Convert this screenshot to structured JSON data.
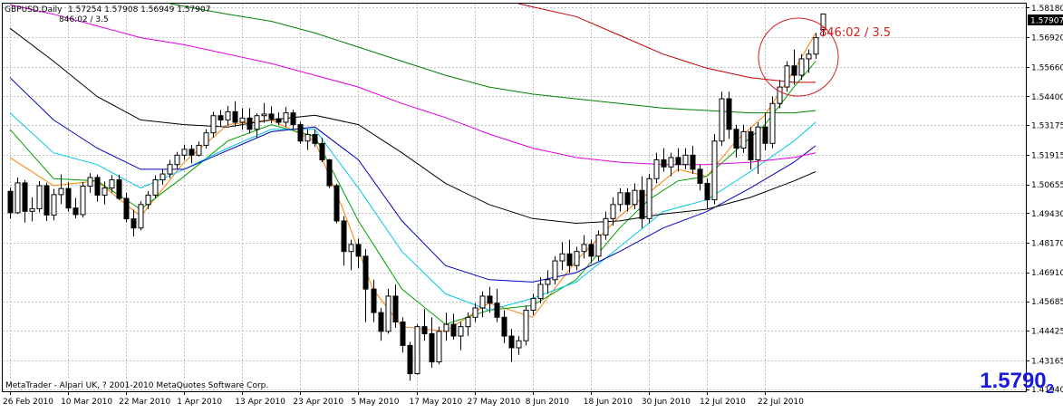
{
  "header": {
    "symbol_tf": "GBPUSD,Daily",
    "ohlc": "1.57254 1.57908 1.56949 1.57907",
    "indicator_readout": "846:02 / 3.5"
  },
  "annotation": {
    "text": "846:02 / 3.5",
    "color": "#d02020"
  },
  "footer": {
    "copyright": "MetaTrader - Alpari UK, ? 2001-2010 MetaQuotes Software Corp."
  },
  "price_big": {
    "main": "1.5790",
    "sub": "2",
    "color": "#1a1adf"
  },
  "colors": {
    "bull_body": "#ffffff",
    "bear_body": "#000000",
    "grid": "#c0c0c0",
    "current_price_box": "#000000"
  },
  "chart_data": {
    "type": "candlestick",
    "title": "GBPUSD,Daily",
    "current_price": "1.57907",
    "y_tick_labels": [
      "1.58180",
      "1.56920",
      "1.55660",
      "1.54400",
      "1.53175",
      "1.51915",
      "1.50655",
      "1.49430",
      "1.48170",
      "1.46910",
      "1.45685",
      "1.44425",
      "1.43165",
      "1.41940"
    ],
    "y_ticks": [
      1.5818,
      1.5692,
      1.5566,
      1.544,
      1.53175,
      1.51915,
      1.50655,
      1.4943,
      1.4817,
      1.4691,
      1.45685,
      1.44425,
      1.43165,
      1.4194
    ],
    "ylim": [
      1.4185,
      1.5835
    ],
    "x_tick_labels": [
      "26 Feb 2010",
      "10 Mar 2010",
      "22 Mar 2010",
      "1 Apr 2010",
      "13 Apr 2010",
      "23 Apr 2010",
      "5 May 2010",
      "17 May 2010",
      "27 May 2010",
      "8 Jun 2010",
      "18 Jun 2010",
      "30 Jun 2010",
      "12 Jul 2010",
      "22 Jul 2010"
    ],
    "x_tick_bar_index": [
      0,
      8,
      16,
      24,
      32,
      40,
      48,
      56,
      64,
      72,
      80,
      88,
      96,
      104
    ],
    "bar_count": 110,
    "candles_ohlc": [
      [
        1.5036,
        1.5052,
        1.492,
        1.4945
      ],
      [
        1.4945,
        1.5095,
        1.494,
        1.5072
      ],
      [
        1.5072,
        1.5084,
        1.4903,
        1.4951
      ],
      [
        1.4951,
        1.501,
        1.4908,
        1.4962
      ],
      [
        1.4962,
        1.508,
        1.4947,
        1.506
      ],
      [
        1.506,
        1.5072,
        1.491,
        1.4935
      ],
      [
        1.4935,
        1.5046,
        1.4912,
        1.5022
      ],
      [
        1.5022,
        1.5108,
        1.4982,
        1.5048
      ],
      [
        1.5048,
        1.5074,
        1.495,
        1.4965
      ],
      [
        1.4965,
        1.5008,
        1.4922,
        1.4937
      ],
      [
        1.4937,
        1.5075,
        1.4924,
        1.5058
      ],
      [
        1.5058,
        1.5113,
        1.503,
        1.5095
      ],
      [
        1.5095,
        1.5108,
        1.4992,
        1.502
      ],
      [
        1.502,
        1.5078,
        1.498,
        1.505
      ],
      [
        1.505,
        1.5105,
        1.5031,
        1.5085
      ],
      [
        1.5085,
        1.5107,
        1.4999,
        1.5006
      ],
      [
        1.5006,
        1.503,
        1.4905,
        1.4919
      ],
      [
        1.4919,
        1.4958,
        1.4844,
        1.488
      ],
      [
        1.488,
        1.4994,
        1.487,
        1.498
      ],
      [
        1.498,
        1.5037,
        1.4961,
        1.502
      ],
      [
        1.502,
        1.5104,
        1.5006,
        1.5085
      ],
      [
        1.5085,
        1.513,
        1.5065,
        1.511
      ],
      [
        1.511,
        1.517,
        1.5092,
        1.515
      ],
      [
        1.515,
        1.5204,
        1.5132,
        1.519
      ],
      [
        1.519,
        1.5235,
        1.517,
        1.5215
      ],
      [
        1.5215,
        1.5234,
        1.5155,
        1.519
      ],
      [
        1.519,
        1.5248,
        1.5184,
        1.5232
      ],
      [
        1.5232,
        1.53,
        1.5218,
        1.5285
      ],
      [
        1.5285,
        1.5375,
        1.5265,
        1.5358
      ],
      [
        1.5358,
        1.5382,
        1.5312,
        1.534
      ],
      [
        1.534,
        1.54,
        1.5316,
        1.5375
      ],
      [
        1.5375,
        1.542,
        1.531,
        1.533
      ],
      [
        1.533,
        1.539,
        1.5298,
        1.5348
      ],
      [
        1.5348,
        1.539,
        1.5282,
        1.53
      ],
      [
        1.53,
        1.5368,
        1.5264,
        1.5358
      ],
      [
        1.5358,
        1.5412,
        1.5328,
        1.5365
      ],
      [
        1.5365,
        1.5398,
        1.5325,
        1.5345
      ],
      [
        1.5345,
        1.5372,
        1.5318,
        1.533
      ],
      [
        1.533,
        1.5395,
        1.531,
        1.537
      ],
      [
        1.537,
        1.5383,
        1.53,
        1.532
      ],
      [
        1.532,
        1.5332,
        1.5238,
        1.525
      ],
      [
        1.525,
        1.53,
        1.5212,
        1.5278
      ],
      [
        1.5278,
        1.53,
        1.5225,
        1.524
      ],
      [
        1.524,
        1.5263,
        1.516,
        1.517
      ],
      [
        1.517,
        1.5174,
        1.505,
        1.506
      ],
      [
        1.506,
        1.5068,
        1.49,
        1.491
      ],
      [
        1.491,
        1.493,
        1.472,
        1.478
      ],
      [
        1.478,
        1.483,
        1.47,
        1.481
      ],
      [
        1.481,
        1.4835,
        1.471,
        1.476
      ],
      [
        1.476,
        1.479,
        1.448,
        1.462
      ],
      [
        1.462,
        1.466,
        1.448,
        1.452
      ],
      [
        1.452,
        1.454,
        1.44,
        1.444
      ],
      [
        1.444,
        1.462,
        1.443,
        1.459
      ],
      [
        1.459,
        1.464,
        1.4455,
        1.448
      ],
      [
        1.448,
        1.45,
        1.435,
        1.438
      ],
      [
        1.438,
        1.4395,
        1.423,
        1.426
      ],
      [
        1.426,
        1.447,
        1.4255,
        1.446
      ],
      [
        1.446,
        1.4535,
        1.44,
        1.443
      ],
      [
        1.443,
        1.45,
        1.4285,
        1.431
      ],
      [
        1.431,
        1.446,
        1.43,
        1.444
      ],
      [
        1.444,
        1.452,
        1.44,
        1.447
      ],
      [
        1.447,
        1.4515,
        1.4405,
        1.442
      ],
      [
        1.442,
        1.448,
        1.436,
        1.446
      ],
      [
        1.446,
        1.452,
        1.442,
        1.45
      ],
      [
        1.45,
        1.456,
        1.448,
        1.454
      ],
      [
        1.454,
        1.461,
        1.45,
        1.459
      ],
      [
        1.459,
        1.463,
        1.452,
        1.456
      ],
      [
        1.456,
        1.462,
        1.448,
        1.45
      ],
      [
        1.45,
        1.453,
        1.439,
        1.442
      ],
      [
        1.442,
        1.445,
        1.431,
        1.437
      ],
      [
        1.437,
        1.442,
        1.434,
        1.44
      ],
      [
        1.44,
        1.455,
        1.438,
        1.453
      ],
      [
        1.453,
        1.46,
        1.451,
        1.458
      ],
      [
        1.458,
        1.467,
        1.456,
        1.464
      ],
      [
        1.464,
        1.47,
        1.46,
        1.466
      ],
      [
        1.466,
        1.476,
        1.464,
        1.474
      ],
      [
        1.474,
        1.482,
        1.47,
        1.477
      ],
      [
        1.477,
        1.483,
        1.469,
        1.472
      ],
      [
        1.472,
        1.48,
        1.47,
        1.478
      ],
      [
        1.478,
        1.485,
        1.475,
        1.481
      ],
      [
        1.481,
        1.483,
        1.473,
        1.476
      ],
      [
        1.476,
        1.487,
        1.474,
        1.485
      ],
      [
        1.485,
        1.495,
        1.483,
        1.492
      ],
      [
        1.492,
        1.501,
        1.489,
        1.498
      ],
      [
        1.498,
        1.505,
        1.495,
        1.503
      ],
      [
        1.503,
        1.505,
        1.495,
        1.498
      ],
      [
        1.498,
        1.507,
        1.496,
        1.504
      ],
      [
        1.504,
        1.51,
        1.488,
        1.492
      ],
      [
        1.492,
        1.511,
        1.49,
        1.509
      ],
      [
        1.509,
        1.52,
        1.507,
        1.517
      ],
      [
        1.517,
        1.522,
        1.512,
        1.514
      ],
      [
        1.514,
        1.52,
        1.51,
        1.518
      ],
      [
        1.518,
        1.522,
        1.512,
        1.515
      ],
      [
        1.515,
        1.522,
        1.513,
        1.519
      ],
      [
        1.519,
        1.523,
        1.511,
        1.513
      ],
      [
        1.513,
        1.515,
        1.504,
        1.507
      ],
      [
        1.507,
        1.509,
        1.496,
        1.5
      ],
      [
        1.5,
        1.528,
        1.498,
        1.525
      ],
      [
        1.525,
        1.546,
        1.523,
        1.543
      ],
      [
        1.543,
        1.546,
        1.526,
        1.53
      ],
      [
        1.53,
        1.532,
        1.518,
        1.522
      ],
      [
        1.522,
        1.532,
        1.52,
        1.529
      ],
      [
        1.529,
        1.531,
        1.513,
        1.517
      ],
      [
        1.517,
        1.533,
        1.511,
        1.531
      ],
      [
        1.531,
        1.537,
        1.521,
        1.524
      ],
      [
        1.524,
        1.544,
        1.522,
        1.541
      ],
      [
        1.541,
        1.551,
        1.539,
        1.548
      ],
      [
        1.548,
        1.559,
        1.546,
        1.557
      ],
      [
        1.557,
        1.564,
        1.549,
        1.553
      ],
      [
        1.553,
        1.562,
        1.551,
        1.56
      ],
      [
        1.56,
        1.564,
        1.554,
        1.562
      ],
      [
        1.562,
        1.571,
        1.56,
        1.569
      ],
      [
        1.5725,
        1.5791,
        1.5695,
        1.5791
      ]
    ],
    "series": [
      {
        "color": "#ff8000",
        "points": [
          [
            0,
            1.518
          ],
          [
            6,
            1.506
          ],
          [
            12,
            1.508
          ],
          [
            18,
            1.493
          ],
          [
            24,
            1.516
          ],
          [
            30,
            1.532
          ],
          [
            36,
            1.534
          ],
          [
            42,
            1.525
          ],
          [
            46,
            1.495
          ],
          [
            50,
            1.462
          ],
          [
            54,
            1.446
          ],
          [
            60,
            1.444
          ],
          [
            66,
            1.456
          ],
          [
            72,
            1.45
          ],
          [
            78,
            1.474
          ],
          [
            84,
            1.493
          ],
          [
            88,
            1.503
          ],
          [
            92,
            1.513
          ],
          [
            96,
            1.51
          ],
          [
            100,
            1.525
          ],
          [
            104,
            1.536
          ],
          [
            108,
            1.555
          ],
          [
            111,
            1.571
          ]
        ]
      },
      {
        "color": "#00a000",
        "points": [
          [
            0,
            1.53
          ],
          [
            6,
            1.509
          ],
          [
            12,
            1.508
          ],
          [
            18,
            1.496
          ],
          [
            24,
            1.51
          ],
          [
            30,
            1.525
          ],
          [
            36,
            1.532
          ],
          [
            42,
            1.527
          ],
          [
            48,
            1.491
          ],
          [
            54,
            1.462
          ],
          [
            60,
            1.447
          ],
          [
            66,
            1.453
          ],
          [
            72,
            1.455
          ],
          [
            78,
            1.466
          ],
          [
            84,
            1.488
          ],
          [
            88,
            1.5
          ],
          [
            92,
            1.508
          ],
          [
            96,
            1.51
          ],
          [
            100,
            1.521
          ],
          [
            104,
            1.532
          ],
          [
            108,
            1.548
          ],
          [
            111,
            1.559
          ]
        ]
      },
      {
        "color": "#00c8e8",
        "points": [
          [
            0,
            1.537
          ],
          [
            6,
            1.52
          ],
          [
            12,
            1.515
          ],
          [
            18,
            1.505
          ],
          [
            24,
            1.513
          ],
          [
            30,
            1.522
          ],
          [
            36,
            1.53
          ],
          [
            42,
            1.53
          ],
          [
            48,
            1.505
          ],
          [
            54,
            1.478
          ],
          [
            60,
            1.46
          ],
          [
            66,
            1.453
          ],
          [
            72,
            1.458
          ],
          [
            78,
            1.465
          ],
          [
            84,
            1.48
          ],
          [
            90,
            1.495
          ],
          [
            96,
            1.5
          ],
          [
            102,
            1.512
          ],
          [
            108,
            1.525
          ],
          [
            111,
            1.533
          ]
        ]
      },
      {
        "color": "#0000c0",
        "points": [
          [
            0,
            1.552
          ],
          [
            6,
            1.534
          ],
          [
            12,
            1.522
          ],
          [
            18,
            1.513
          ],
          [
            24,
            1.513
          ],
          [
            30,
            1.521
          ],
          [
            36,
            1.529
          ],
          [
            42,
            1.531
          ],
          [
            48,
            1.517
          ],
          [
            54,
            1.491
          ],
          [
            60,
            1.472
          ],
          [
            66,
            1.466
          ],
          [
            72,
            1.465
          ],
          [
            78,
            1.469
          ],
          [
            84,
            1.478
          ],
          [
            90,
            1.488
          ],
          [
            96,
            1.495
          ],
          [
            102,
            1.505
          ],
          [
            108,
            1.516
          ],
          [
            111,
            1.523
          ]
        ]
      },
      {
        "color": "#000000",
        "points": [
          [
            0,
            1.573
          ],
          [
            6,
            1.559
          ],
          [
            12,
            1.544
          ],
          [
            18,
            1.534
          ],
          [
            24,
            1.532
          ],
          [
            30,
            1.531
          ],
          [
            36,
            1.534
          ],
          [
            42,
            1.536
          ],
          [
            48,
            1.532
          ],
          [
            54,
            1.52
          ],
          [
            60,
            1.507
          ],
          [
            66,
            1.498
          ],
          [
            72,
            1.492
          ],
          [
            78,
            1.49
          ],
          [
            84,
            1.491
          ],
          [
            90,
            1.494
          ],
          [
            96,
            1.496
          ],
          [
            102,
            1.501
          ],
          [
            108,
            1.508
          ],
          [
            111,
            1.512
          ]
        ]
      },
      {
        "color": "#e000e0",
        "points": [
          [
            0,
            1.583
          ],
          [
            6,
            1.579
          ],
          [
            12,
            1.574
          ],
          [
            18,
            1.569
          ],
          [
            24,
            1.566
          ],
          [
            30,
            1.562
          ],
          [
            36,
            1.558
          ],
          [
            42,
            1.553
          ],
          [
            48,
            1.548
          ],
          [
            54,
            1.541
          ],
          [
            60,
            1.535
          ],
          [
            66,
            1.528
          ],
          [
            72,
            1.522
          ],
          [
            78,
            1.518
          ],
          [
            84,
            1.516
          ],
          [
            90,
            1.515
          ],
          [
            96,
            1.515
          ],
          [
            102,
            1.516
          ],
          [
            108,
            1.518
          ],
          [
            111,
            1.52
          ]
        ]
      },
      {
        "color": "#008000",
        "points": [
          [
            22,
            1.5835
          ],
          [
            30,
            1.579
          ],
          [
            36,
            1.576
          ],
          [
            42,
            1.571
          ],
          [
            48,
            1.565
          ],
          [
            54,
            1.559
          ],
          [
            60,
            1.553
          ],
          [
            66,
            1.548
          ],
          [
            72,
            1.545
          ],
          [
            78,
            1.543
          ],
          [
            84,
            1.541
          ],
          [
            90,
            1.539
          ],
          [
            96,
            1.538
          ],
          [
            102,
            1.537
          ],
          [
            108,
            1.537
          ],
          [
            111,
            1.538
          ]
        ]
      },
      {
        "color": "#c00000",
        "points": [
          [
            70,
            1.5835
          ],
          [
            78,
            1.578
          ],
          [
            84,
            1.57
          ],
          [
            90,
            1.562
          ],
          [
            96,
            1.556
          ],
          [
            102,
            1.552
          ],
          [
            108,
            1.55
          ],
          [
            111,
            1.55
          ]
        ]
      }
    ]
  }
}
